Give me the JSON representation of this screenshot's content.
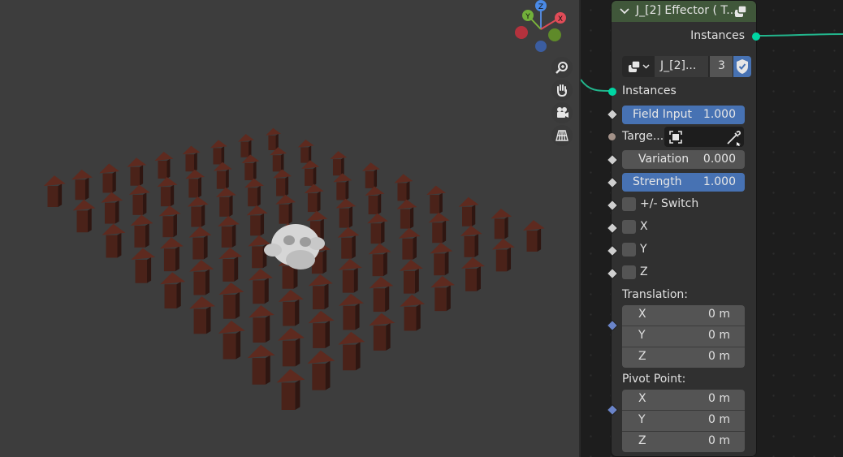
{
  "viewport": {
    "gizmo": {
      "axis_z": "Z",
      "axis_y": "Y",
      "axis_x": "X"
    },
    "nav_icons": [
      "zoom-icon",
      "hand-pan-icon",
      "camera-icon",
      "grid-perspective-icon"
    ]
  },
  "node": {
    "title": "J_[2] Effector ( T...",
    "output_instances": "Instances",
    "datablock": {
      "name": "J_[2]...",
      "users": "3"
    },
    "input_instances": "Instances",
    "field_input": {
      "label": "Field Input",
      "value": "1.000"
    },
    "target_label": "Targe...",
    "variation": {
      "label": "Variation",
      "value": "0.000"
    },
    "strength": {
      "label": "Strength",
      "value": "1.000"
    },
    "checkboxes": {
      "switch": "+/- Switch",
      "x": "X",
      "y": "Y",
      "z": "Z"
    },
    "translation": {
      "label": "Translation:",
      "rows": [
        {
          "axis": "X",
          "value": "0 m"
        },
        {
          "axis": "Y",
          "value": "0 m"
        },
        {
          "axis": "Z",
          "value": "0 m"
        }
      ]
    },
    "pivot": {
      "label": "Pivot Point:",
      "rows": [
        {
          "axis": "X",
          "value": "0 m"
        },
        {
          "axis": "Y",
          "value": "0 m"
        },
        {
          "axis": "Z",
          "value": "0 m"
        }
      ]
    }
  },
  "colors": {
    "header_green": "#40573a",
    "field_blue": "#4772b3",
    "socket_teal": "#00d6a3",
    "arrow_red": "#5a2a1f"
  }
}
